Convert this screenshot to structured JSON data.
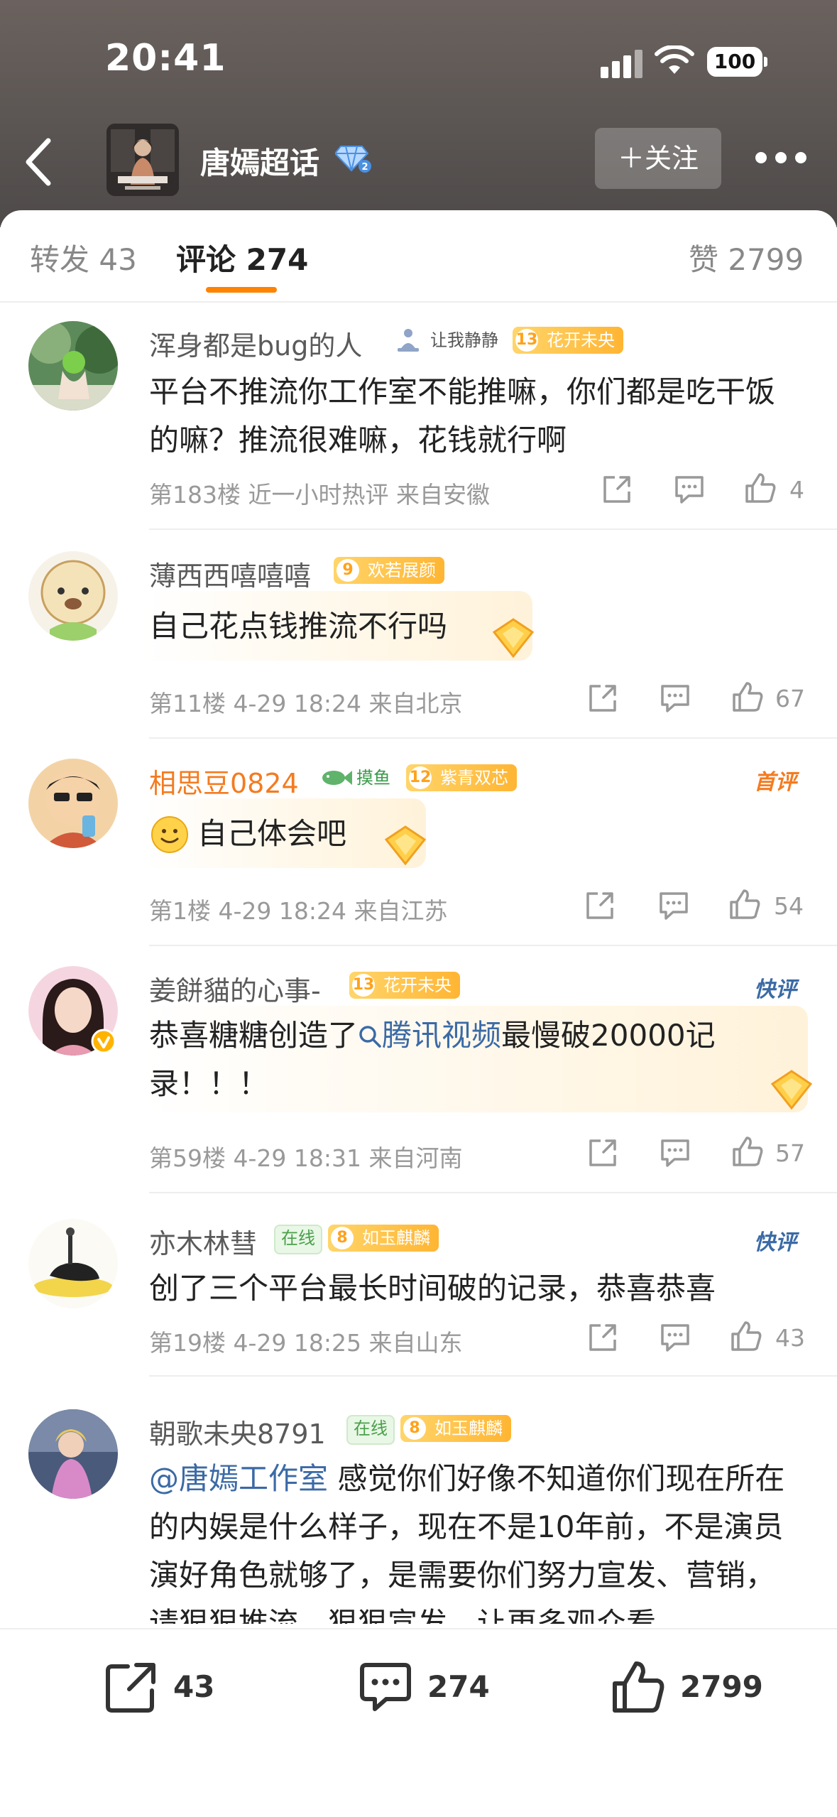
{
  "status_bar": {
    "time": "20:41",
    "battery": "100"
  },
  "nav": {
    "title": "唐嫣超话",
    "follow_label": "＋关注"
  },
  "tabs": {
    "repost_label": "转发 43",
    "comment_label": "评论 274",
    "like_label": "赞 2799"
  },
  "comments": [
    {
      "username": "浑身都是bug的人",
      "badges": [
        {
          "type": "gray",
          "text": "让我静静"
        },
        {
          "type": "level",
          "level": "13",
          "text": "花开未央"
        }
      ],
      "text": "平台不推流你工作室不能推嘛，你们都是吃干饭的嘛？推流很难嘛，花钱就行啊",
      "meta": "第183楼  近一小时热评  来自安徽",
      "likes": "4"
    },
    {
      "username": "薄西西嘻嘻嘻",
      "badges": [
        {
          "type": "level",
          "level": "9",
          "text": "欢若展颜"
        }
      ],
      "text": "自己花点钱推流不行吗",
      "meta": "第11楼  4-29 18:24  来自北京",
      "likes": "67"
    },
    {
      "username": "相思豆0824",
      "badges": [
        {
          "type": "fish",
          "text": "摸鱼"
        },
        {
          "type": "level",
          "level": "12",
          "text": "紫青双芯"
        }
      ],
      "tag": "首评",
      "text": "自己体会吧",
      "meta": "第1楼  4-29 18:24  来自江苏",
      "likes": "54"
    },
    {
      "username": "姜餅貓的心事-",
      "badges": [
        {
          "type": "level",
          "level": "13",
          "text": "花开未央"
        }
      ],
      "tag": "快评",
      "text_before": "恭喜糖糖创造了",
      "text_link": "腾讯视频",
      "text_after": "最慢破20000记录！！！",
      "meta": "第59楼  4-29 18:31  来自河南",
      "likes": "57"
    },
    {
      "username": "亦木林彗",
      "badges": [
        {
          "type": "green",
          "text": "在线"
        },
        {
          "type": "level",
          "level": "8",
          "text": "如玉麒麟"
        }
      ],
      "tag": "快评",
      "text": "创了三个平台最长时间破的记录，恭喜恭喜",
      "meta": "第19楼  4-29 18:25  来自山东",
      "likes": "43"
    },
    {
      "username": "朝歌未央8791",
      "badges": [
        {
          "type": "green",
          "text": "在线"
        },
        {
          "type": "level",
          "level": "8",
          "text": "如玉麒麟"
        }
      ],
      "text_link": "@唐嫣工作室",
      "text_after": " 感觉你们好像不知道你们现在所在的内娱是什么样子，现在不是10年前，不是演员演好角色就够了，是需要你们努力宣发、营销，请狠狠推流，狠狠宣发，让更多观众看"
    }
  ],
  "bottom_bar": {
    "reposts": "43",
    "comments": "274",
    "likes": "2799"
  },
  "colors": {
    "accent": "#ff8200",
    "link": "#3b6aa6",
    "badge_gold": "#ffb533"
  }
}
